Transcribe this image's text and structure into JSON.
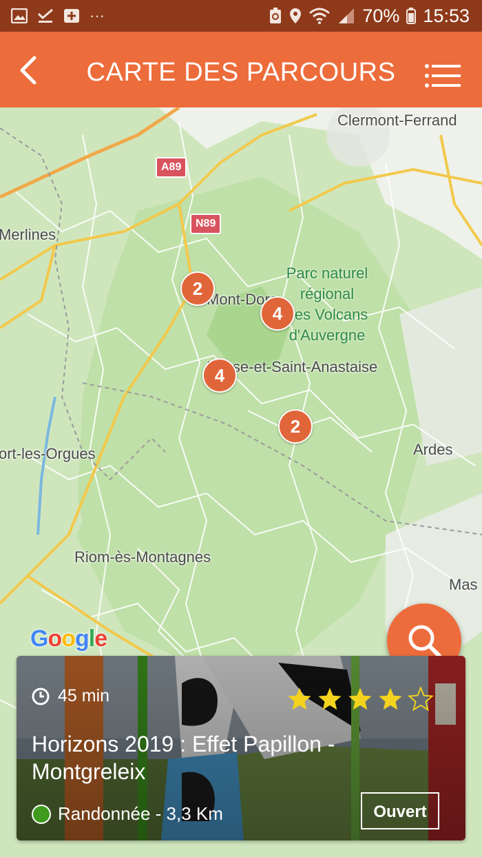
{
  "status_bar": {
    "battery": "70%",
    "time": "15:53",
    "overflow": "···"
  },
  "app_bar": {
    "title": "CARTE DES PARCOURS"
  },
  "map": {
    "places": {
      "clermont": "Clermont-Ferrand",
      "merlines": "Merlines",
      "montdore": "Mont-Dore",
      "besse": "Besse-et-Saint-Anastaise",
      "bort": "ort-les-Orgues",
      "ardes": "Ardes",
      "riom": "Riom-ès-Montagnes",
      "massiac": "Mas"
    },
    "park": [
      "Parc naturel",
      "régional",
      "des Volcans",
      "d'Auvergne"
    ],
    "roads": {
      "a89": "A89",
      "n89": "N89"
    },
    "clusters": [
      "2",
      "4",
      "4",
      "2"
    ],
    "attribution": "Google"
  },
  "card": {
    "duration": "45 min",
    "rating": 4,
    "rating_max": 5,
    "title": "Horizons 2019 : Effet Papillon - Montgreleix",
    "category": "Randonnée - 3,3 Km",
    "status": "Ouvert"
  },
  "colors": {
    "accent": "#ed6c3b",
    "status_bar": "#8e3a1a",
    "star": "#f4d31f",
    "category": "#3f9a1e"
  }
}
